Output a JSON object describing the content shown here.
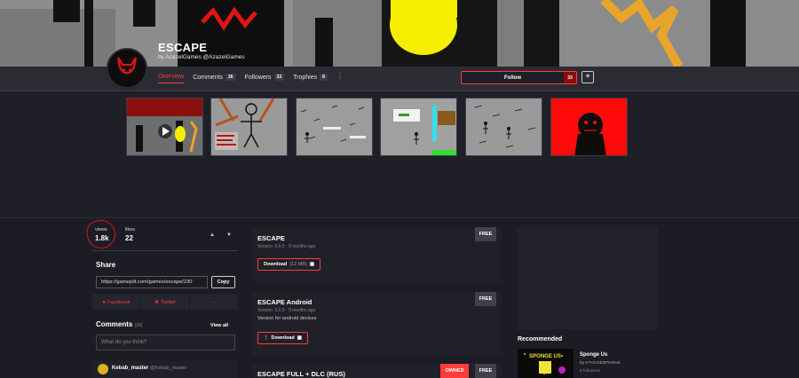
{
  "game": {
    "title": "ESCAPE",
    "byline": "by AzazelGames @AzazelGames"
  },
  "nav": {
    "tabs": [
      {
        "label": "Overview"
      },
      {
        "label": "Comments",
        "count": "26"
      },
      {
        "label": "Followers",
        "count": "33"
      },
      {
        "label": "Trophies",
        "count": "8"
      }
    ],
    "more": "⋮"
  },
  "follow": {
    "label": "Follow",
    "count": "33",
    "plus": "+"
  },
  "stats": {
    "views_label": "views",
    "views_value": "1.8k",
    "likes_label": "likes",
    "likes_value": "22"
  },
  "share": {
    "title": "Share",
    "url": "https://gamejolt.com/games/escape/230",
    "copy_label": "Copy",
    "facebook": "Facebook",
    "twitter": "Twitter",
    "more": "···"
  },
  "comments": {
    "title": "Comments",
    "count": "(26)",
    "view_all": "View all",
    "placeholder": "What do you think?",
    "first_user": "Kebab_master",
    "first_handle": "@Kebab_master"
  },
  "packages": [
    {
      "title": "ESCAPE",
      "meta": "Version: 3.0.0  ·  9 months ago",
      "badge": "FREE",
      "download": "Download",
      "size": "(12 MB)"
    },
    {
      "title": "ESCAPE Android",
      "meta": "Version: 3.0.0  ·  9 months ago",
      "desc": "Version for android devices",
      "badge": "FREE",
      "download": "Download"
    },
    {
      "title": "ESCAPE FULL + DLC (RUS)",
      "badge": "FREE",
      "owned": "OWNED"
    }
  ],
  "recommended": {
    "title": "Recommended",
    "name": "Sponge Us",
    "by": "by KTVCREEPERnet",
    "followers": "8 followers",
    "thumb_text": "SPONGE US"
  },
  "colors": {
    "accent": "#ff3c3c",
    "background": "#191a21",
    "panel": "#202128"
  }
}
